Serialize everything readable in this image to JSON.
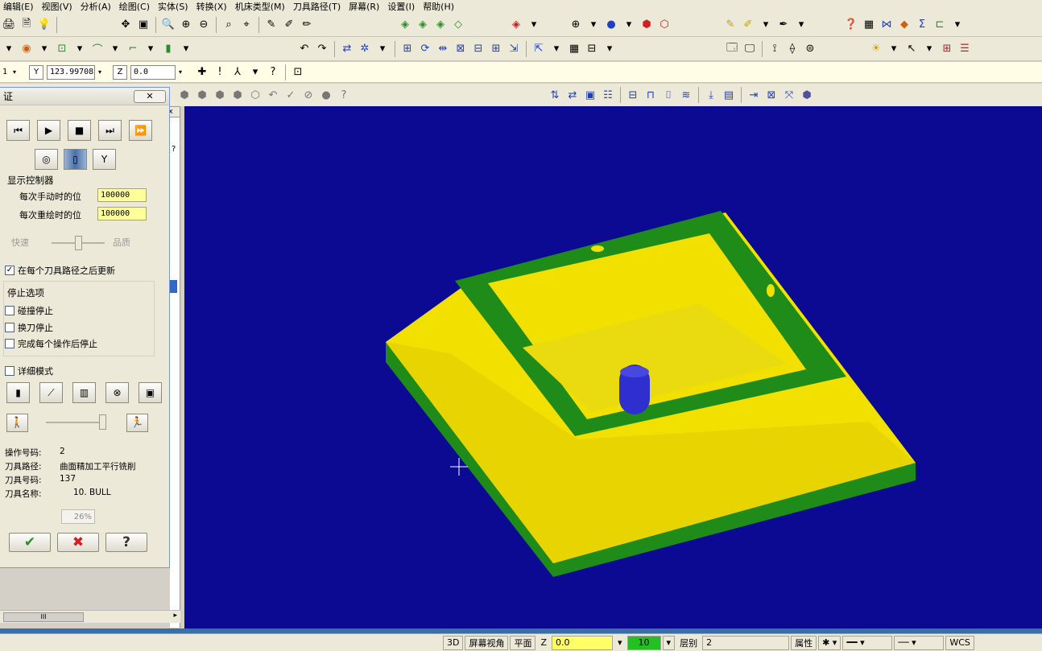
{
  "menu": [
    "编辑(E)",
    "视图(V)",
    "分析(A)",
    "绘图(C)",
    "实体(S)",
    "转换(X)",
    "机床类型(M)",
    "刀具路径(T)",
    "屏幕(R)",
    "设置(I)",
    "帮助(H)"
  ],
  "coords": {
    "level_value": "1",
    "y_label": "Y",
    "y_value": "123.99708",
    "z_label": "Z",
    "z_value": "0.0"
  },
  "dialog": {
    "title": "证",
    "close_glyph": "✕",
    "display_group": "显示控制器",
    "manual_step_label": "每次手动时的位",
    "manual_step_value": "100000",
    "redraw_step_label": "每次重绘时的位",
    "redraw_step_value": "100000",
    "speed_label": "快速",
    "quality_label": "品质",
    "update_each_path": "在每个刀具路径之后更新",
    "update_each_path_checked": true,
    "stop_group": "停止选项",
    "stop_on_collision": "碰撞停止",
    "stop_on_tool_change": "换刀停止",
    "stop_after_each_op": "完成每个操作后停止",
    "verbose_mode": "详细模式",
    "info": {
      "op_number_key": "操作号码:",
      "op_number_value": "2",
      "toolpath_key": "刀具路径:",
      "toolpath_value": "曲面精加工平行铣削",
      "tool_number_key": "刀具号码:",
      "tool_number_value": "137",
      "tool_name_key": "刀具名称:",
      "tool_name_value": "10.  BULL"
    },
    "progress": "26%",
    "ok_glyph": "✔",
    "cancel_glyph": "✖",
    "help_glyph": "?"
  },
  "sidestrip": {
    "header": "x",
    "scroll_label": "III"
  },
  "status": {
    "mode_3d": "3D",
    "screen_view": "屏幕视角",
    "plane": "平面",
    "z_label": "Z",
    "z_value": "0.0",
    "color_value": "10",
    "layer_label": "层别",
    "layer_value": "2",
    "attributes": "属性",
    "wcs": "WCS"
  },
  "colors": {
    "viewport_bg": "#0c0a93",
    "part_yellow": "#f2e000",
    "part_green": "#1f8c1a",
    "tool_blue": "#2f2fd0"
  }
}
